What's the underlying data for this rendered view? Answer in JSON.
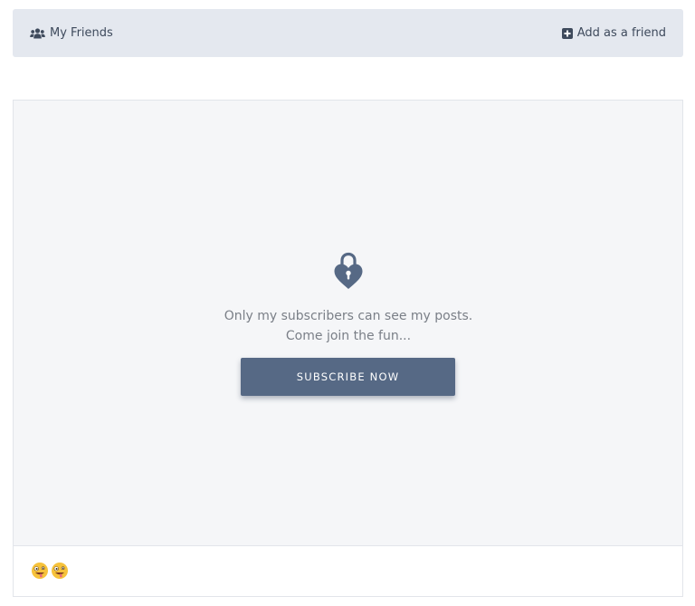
{
  "friends_bar": {
    "my_friends_label": "My Friends",
    "my_friends_icon": "users-icon",
    "add_friend_label": "Add as a friend",
    "add_friend_icon": "plus-square-icon"
  },
  "locked_post": {
    "icon": "heart-lock-icon",
    "message": "Only my subscribers can see my posts. Come join the fun...",
    "subscribe_label": "SUBSCRIBE NOW"
  },
  "caption": {
    "emojis": [
      "zany-face-emoji",
      "zany-face-emoji"
    ]
  },
  "colors": {
    "bar_background": "#e4e8ef",
    "locked_background": "#f5f6f8",
    "button_background": "#566985",
    "icon_color": "#566985",
    "text_muted": "#7a7f87"
  }
}
